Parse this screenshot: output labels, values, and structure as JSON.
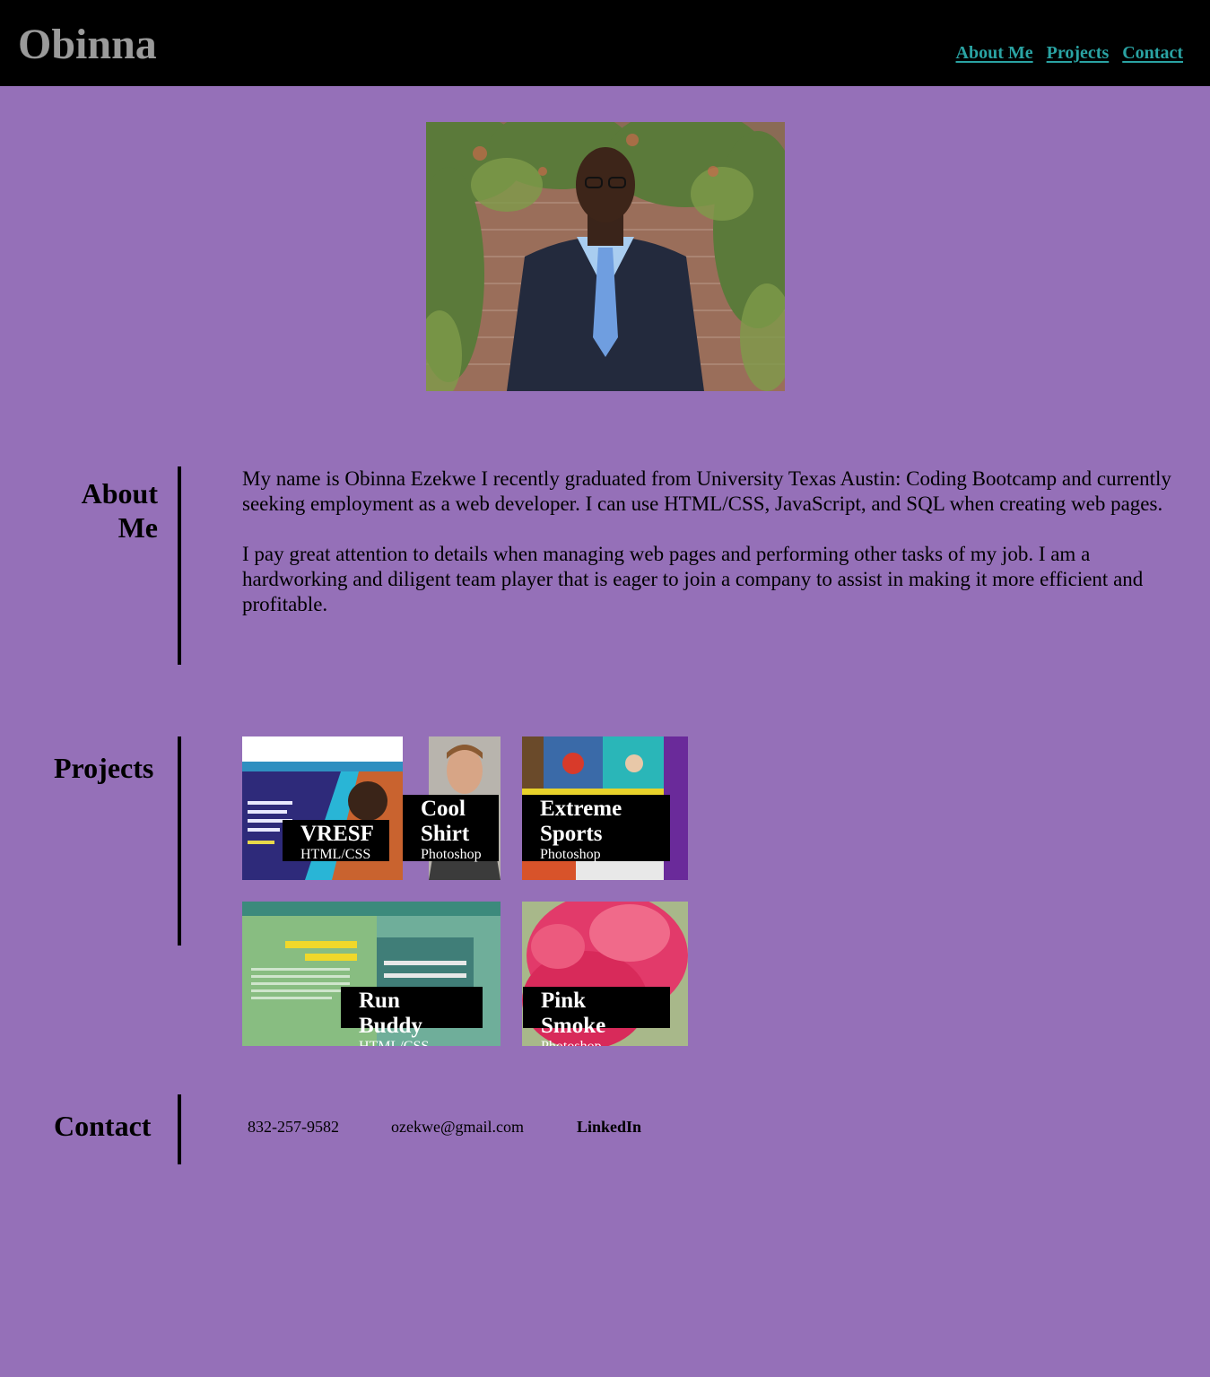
{
  "header": {
    "brand": "Obinna",
    "nav": [
      "About Me",
      "Projects",
      "Contact"
    ]
  },
  "about": {
    "heading": "About Me",
    "heading_line1": "About",
    "heading_line2": "Me",
    "paragraphs": [
      "My name is Obinna Ezekwe I recently graduated from University Texas Austin: Coding Bootcamp and currently seeking employment as a web developer. I can use HTML/CSS, JavaScript, and SQL when creating web pages.",
      "I pay great attention to details when managing web pages and performing other tasks of my job. I am a hardworking and diligent team player that is eager to join a company to assist in making it more efficient and profitable."
    ]
  },
  "projects": {
    "heading": "Projects",
    "items": [
      {
        "title": "VRESF",
        "subtitle": "HTML/CSS"
      },
      {
        "title": "Cool Shirt",
        "title_line1": "Cool",
        "title_line2": "Shirt",
        "subtitle": "Photoshop"
      },
      {
        "title": "Extreme Sports",
        "title_line1": "Extreme",
        "title_line2": "Sports",
        "subtitle": "Photoshop"
      },
      {
        "title": "Run Buddy",
        "subtitle": "HTML/CSS"
      },
      {
        "title": "Pink Smoke",
        "subtitle": "Photoshop"
      }
    ]
  },
  "contact": {
    "heading": "Contact",
    "phone": "832-257-9582",
    "email": "ozekwe@gmail.com",
    "linkedin": "LinkedIn"
  },
  "colors": {
    "background": "#9570b8",
    "header_bg": "#000000",
    "brand": "#9a9a9a",
    "nav_link": "#2aa3a3"
  }
}
